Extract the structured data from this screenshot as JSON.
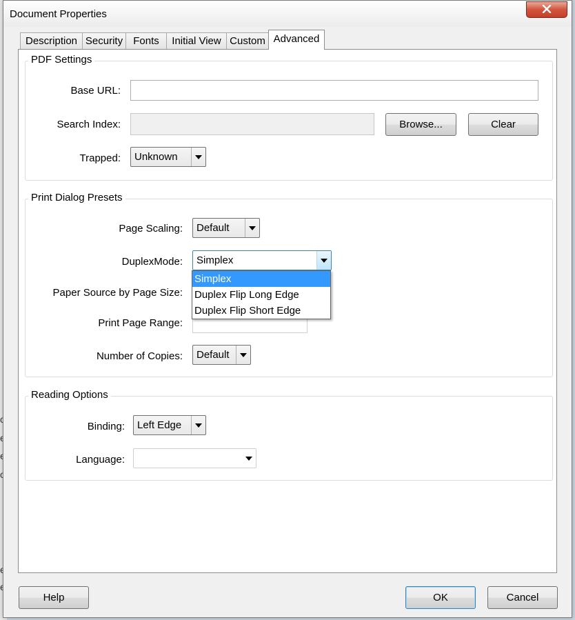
{
  "window": {
    "title": "Document Properties"
  },
  "tabs": [
    {
      "label": "Description"
    },
    {
      "label": "Security"
    },
    {
      "label": "Fonts"
    },
    {
      "label": "Initial View"
    },
    {
      "label": "Custom"
    },
    {
      "label": "Advanced"
    }
  ],
  "pdf_settings": {
    "legend": "PDF Settings",
    "base_url_label": "Base URL:",
    "base_url_value": "",
    "search_index_label": "Search Index:",
    "search_index_value": "",
    "browse_label": "Browse...",
    "clear_label": "Clear",
    "trapped_label": "Trapped:",
    "trapped_value": "Unknown"
  },
  "print_presets": {
    "legend": "Print Dialog Presets",
    "page_scaling_label": "Page Scaling:",
    "page_scaling_value": "Default",
    "duplex_label": "DuplexMode:",
    "duplex_value": "Simplex",
    "duplex_options": [
      "Simplex",
      "Duplex Flip Long Edge",
      "Duplex Flip Short Edge"
    ],
    "paper_source_label": "Paper Source by Page Size:",
    "print_range_label": "Print Page Range:",
    "copies_label": "Number of Copies:",
    "copies_value": "Default"
  },
  "reading_options": {
    "legend": "Reading Options",
    "binding_label": "Binding:",
    "binding_value": "Left Edge",
    "language_label": "Language:",
    "language_value": ""
  },
  "footer": {
    "help_label": "Help",
    "ok_label": "OK",
    "cancel_label": "Cancel"
  },
  "colors": {
    "selection": "#3399ff",
    "close_button": "#c94a33"
  }
}
